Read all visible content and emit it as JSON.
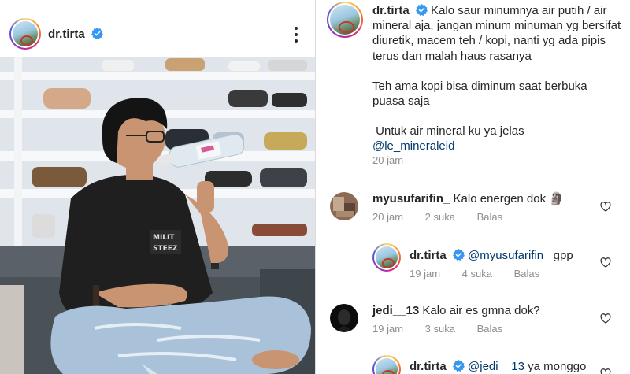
{
  "post": {
    "username": "dr.tirta"
  },
  "caption": {
    "username": "dr.tirta",
    "line1": "Kalo saur minumnya air putih / air mineral aja, jangan minum minuman yg bersifat diuretik, macem teh / kopi, nanti yg ada pipis terus dan malah haus rasanya",
    "line2": "Teh ama kopi bisa diminum saat berbuka puasa saja",
    "line3": "Untuk air mineral ku ya jelas",
    "mention": "@le_mineraleid",
    "time": "20 jam"
  },
  "comments": [
    {
      "username": "myusufarifin_",
      "text": "Kalo energen dok",
      "emoji": "🗿",
      "time": "20 jam",
      "likes": "2 suka",
      "reply": "Balas"
    },
    {
      "username": "dr.tirta",
      "mention": "@myusufarifin_",
      "text": "gpp",
      "time": "19 jam",
      "likes": "4 suka",
      "reply": "Balas"
    },
    {
      "username": "jedi__13",
      "text": "Kalo air es gmna dok?",
      "time": "19 jam",
      "likes": "3 suka",
      "reply": "Balas"
    },
    {
      "username": "dr.tirta",
      "mention": "@jedi__13",
      "text": "ya monggo"
    }
  ],
  "icons": {
    "verified": "verified-badge-icon",
    "more": "more-options-icon",
    "like": "heart-icon"
  },
  "colors": {
    "verified": "#3897f0",
    "mention": "#00376b",
    "meta": "#8e8e8e"
  }
}
